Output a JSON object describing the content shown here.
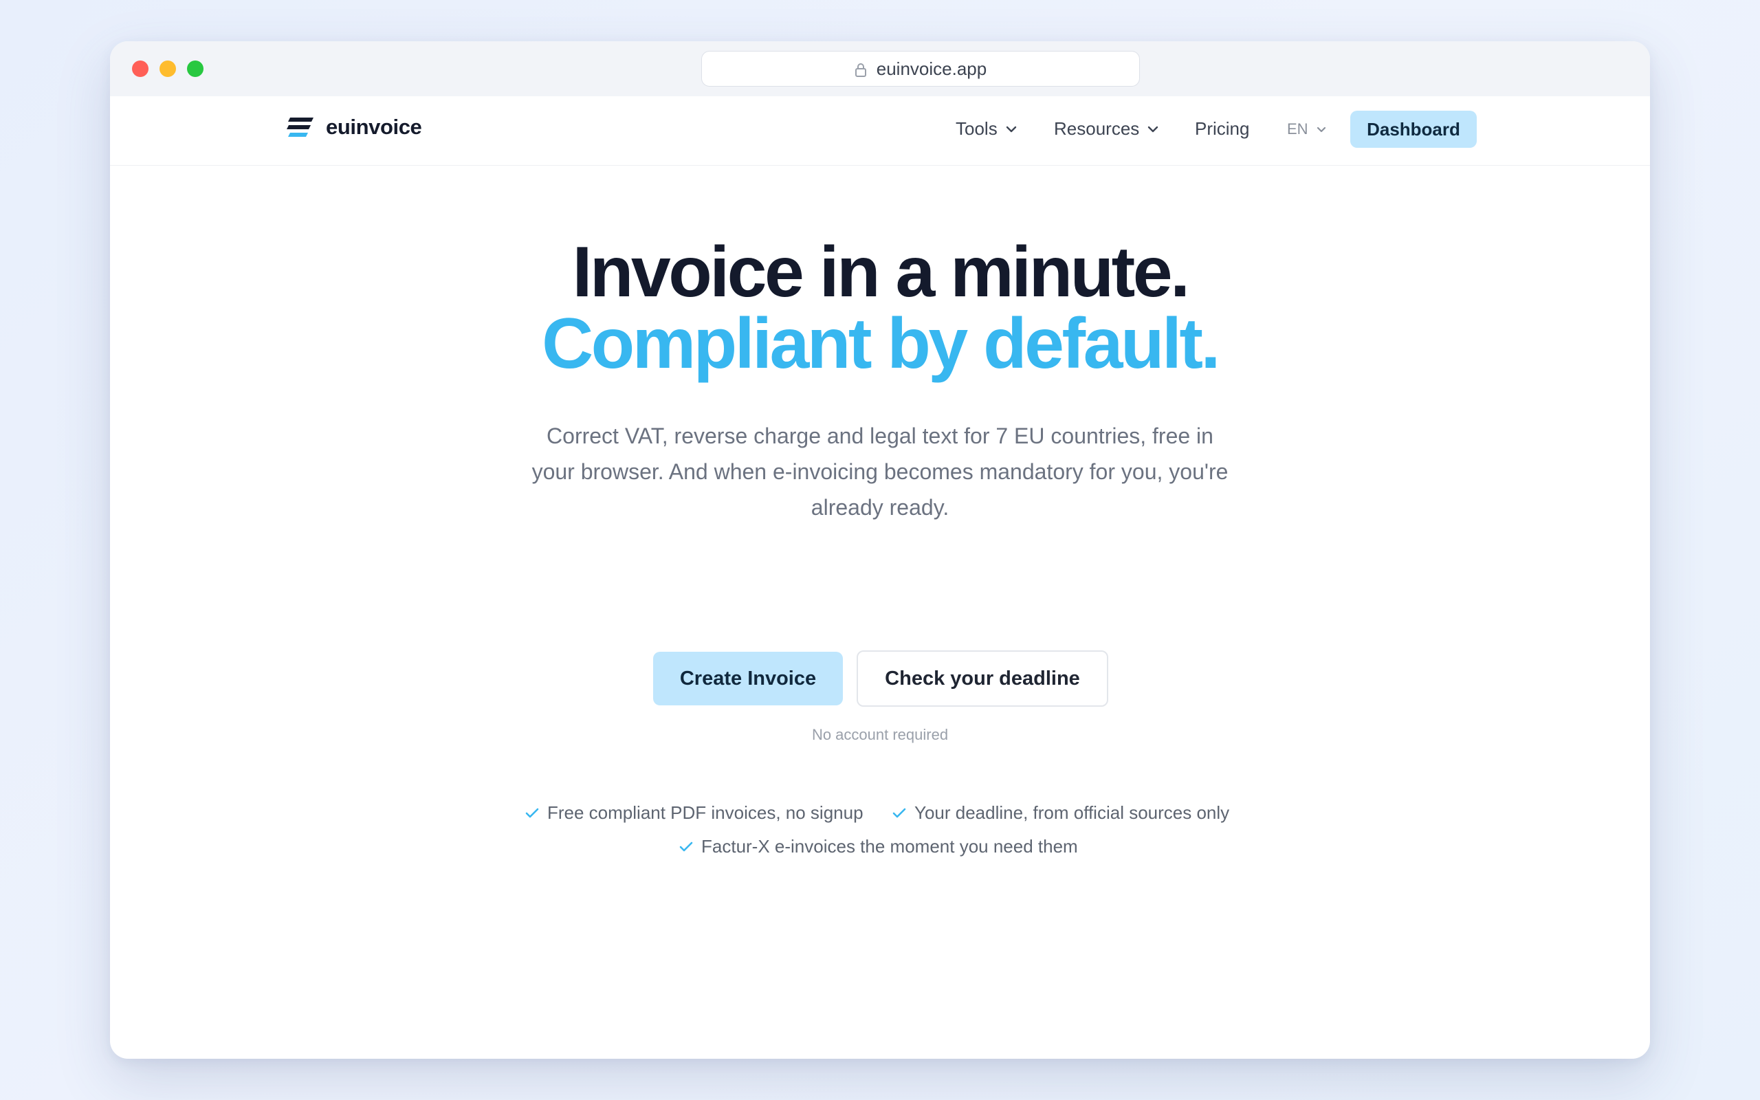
{
  "browser": {
    "url": "euinvoice.app"
  },
  "nav": {
    "logo_text": "euinvoice",
    "items": [
      {
        "label": "Tools",
        "icon": "chevron-down-icon"
      },
      {
        "label": "Resources",
        "icon": "chevron-down-icon"
      },
      {
        "label": "Pricing"
      }
    ],
    "language": "EN",
    "dashboard_label": "Dashboard"
  },
  "hero": {
    "headline_line1": "Invoice in a minute.",
    "headline_line2": "Compliant by default.",
    "subtext": "Correct VAT, reverse charge and legal text for 7 EU countries, free in your browser. And when e-invoicing becomes mandatory for you, you're already ready.",
    "primary_button": "Create Invoice",
    "secondary_button": "Check your deadline",
    "note": "No account required"
  },
  "features": [
    "Free compliant PDF invoices, no signup",
    "Your deadline, from official sources only",
    "Factur-X e-invoices the moment you need them"
  ],
  "colors": {
    "accent": "#38b7f0",
    "button_bg": "#bfe6fd",
    "heading": "#141a2c",
    "check": "#38b7f0"
  }
}
